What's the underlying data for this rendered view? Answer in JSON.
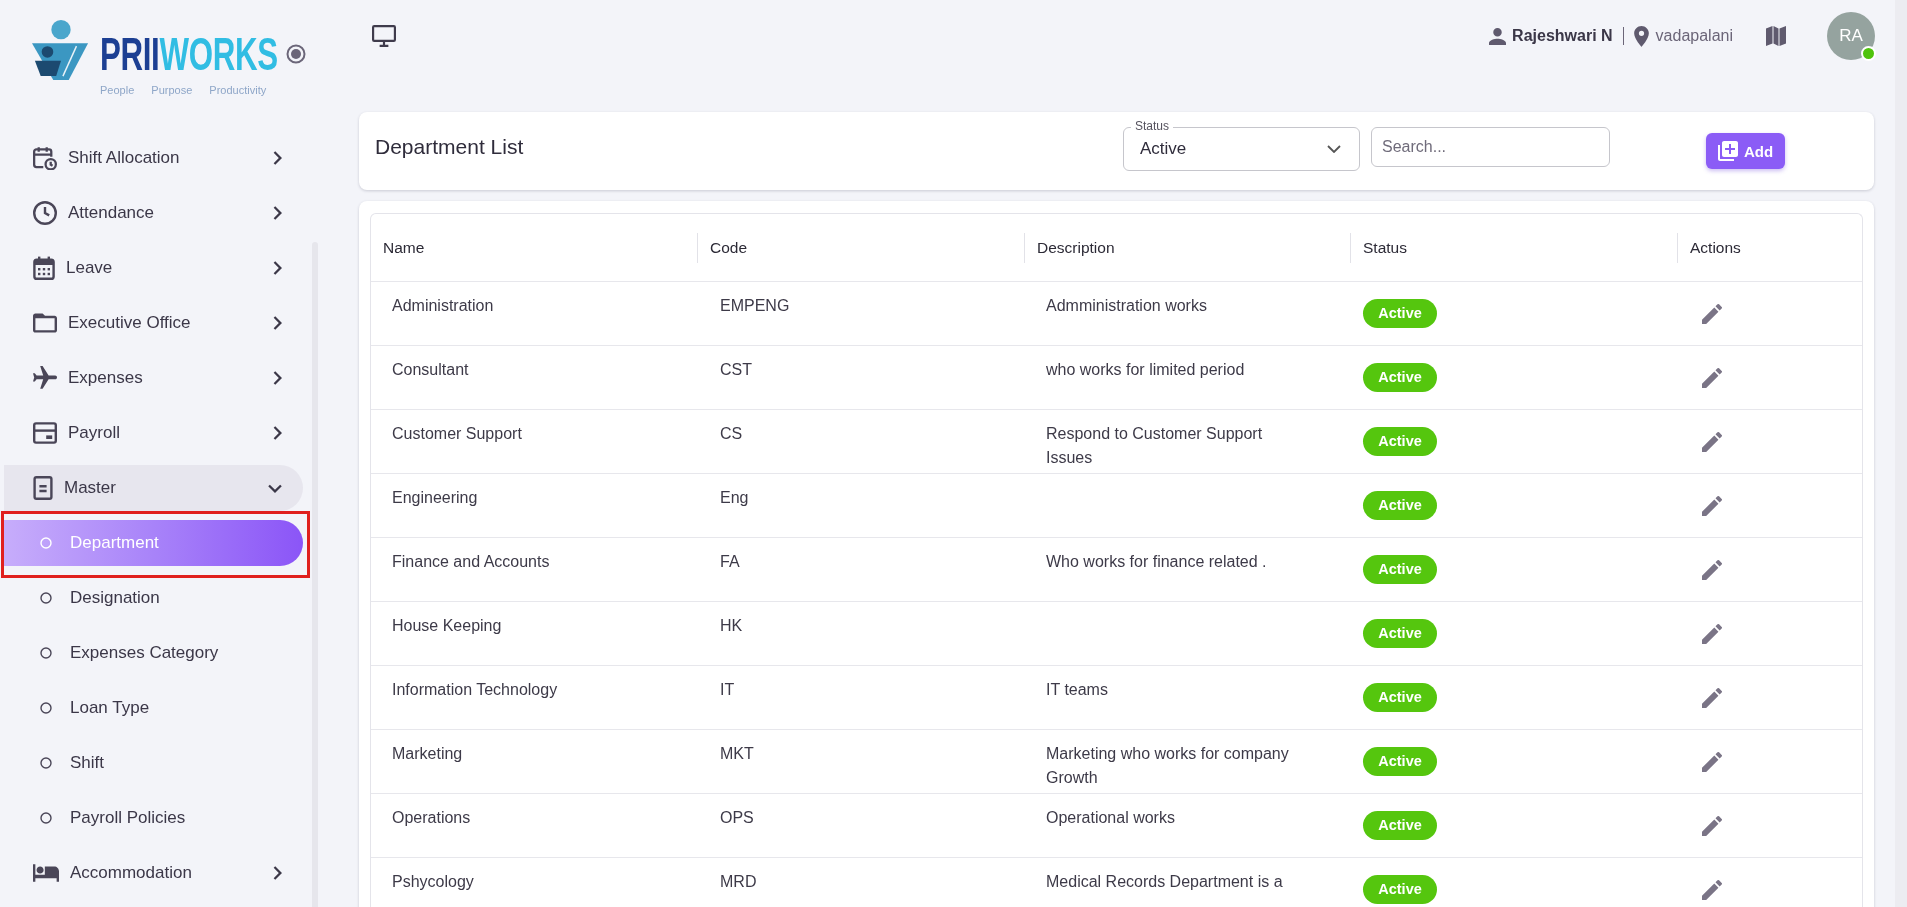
{
  "logo": {
    "wordmark": [
      "PRII",
      "WORKS"
    ],
    "tagline": "People Purpose Productivity"
  },
  "sidebar": {
    "items": [
      {
        "label": "Shift Allocation",
        "expanded": false
      },
      {
        "label": "Attendance",
        "expanded": false
      },
      {
        "label": "Leave",
        "expanded": false
      },
      {
        "label": "Executive Office",
        "expanded": false
      },
      {
        "label": "Expenses",
        "expanded": false
      },
      {
        "label": "Payroll",
        "expanded": false
      },
      {
        "label": "Master",
        "expanded": true,
        "children": [
          {
            "label": "Department",
            "selected": true,
            "annotated": true
          },
          {
            "label": "Designation",
            "selected": false,
            "annotated": false
          },
          {
            "label": "Expenses Category",
            "selected": false,
            "annotated": false
          },
          {
            "label": "Loan Type",
            "selected": false,
            "annotated": false
          },
          {
            "label": "Shift",
            "selected": false,
            "annotated": false
          },
          {
            "label": "Payroll Policies",
            "selected": false,
            "annotated": false
          }
        ]
      },
      {
        "label": "Accommodation",
        "expanded": false
      }
    ]
  },
  "top_bar": {
    "user_name": "Rajeshwari N",
    "location": "vadapalani",
    "avatar": {
      "initials": "RA",
      "online": true
    }
  },
  "page_header": {
    "title": "Department List",
    "status_filter": {
      "label": "Status",
      "value": "Active"
    },
    "search": {
      "placeholder": "Search..."
    },
    "add_button": {
      "label": "Add"
    }
  },
  "table": {
    "columns": [
      "Name",
      "Code",
      "Description",
      "Status",
      "Actions"
    ],
    "rows": [
      {
        "name": "Administration",
        "code": "EMPENG",
        "description": "Admministration works",
        "status": "Active"
      },
      {
        "name": "Consultant",
        "code": "CST",
        "description": "who works for limited period",
        "status": "Active"
      },
      {
        "name": "Customer Support",
        "code": "CS",
        "description": "Respond to Customer Support Issues",
        "status": "Active"
      },
      {
        "name": "Engineering",
        "code": "Eng",
        "status": "Active"
      },
      {
        "name": "Finance and Accounts",
        "code": "FA",
        "description": "Who works for finance related .",
        "status": "Active"
      },
      {
        "name": "House Keeping",
        "code": "HK",
        "status": "Active"
      },
      {
        "name": "Information Technology",
        "code": "IT",
        "description": "IT teams",
        "status": "Active"
      },
      {
        "name": "Marketing",
        "code": "MKT",
        "description": "Marketing who works for company Growth",
        "status": "Active"
      },
      {
        "name": "Operations",
        "code": "OPS",
        "description": "Operational works",
        "status": "Active"
      },
      {
        "name": "Pshycology",
        "code": "MRD",
        "description": "Medical Records Department is a",
        "status": "Active"
      }
    ]
  }
}
